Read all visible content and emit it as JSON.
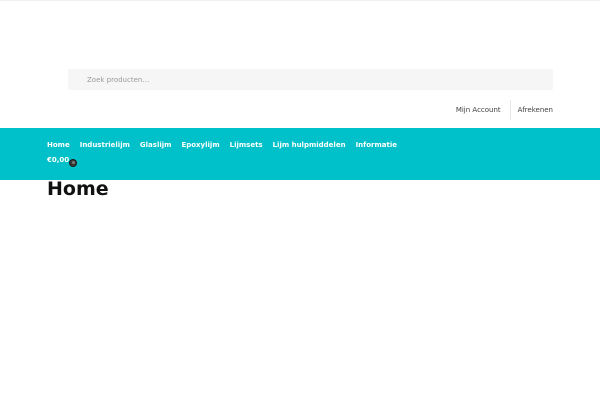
{
  "search": {
    "placeholder": "Zoek producten…"
  },
  "secondary_nav": {
    "items": [
      {
        "label": "Mijn Account"
      },
      {
        "label": "Afrekenen"
      }
    ]
  },
  "primary_menu": {
    "items": [
      {
        "label": "Home"
      },
      {
        "label": "Industrielijm"
      },
      {
        "label": "Glaslijm"
      },
      {
        "label": "Epoxylijm"
      },
      {
        "label": "Lijmsets"
      },
      {
        "label": "Lijm hulpmiddelen"
      },
      {
        "label": "Informatie"
      }
    ]
  },
  "cart": {
    "amount": "€0,00",
    "icon": "cart-count-icon"
  },
  "page": {
    "title": "Home"
  },
  "colors": {
    "nav_background": "#00c0c9",
    "nav_text": "#ffffff",
    "search_background": "#f6f6f6"
  }
}
